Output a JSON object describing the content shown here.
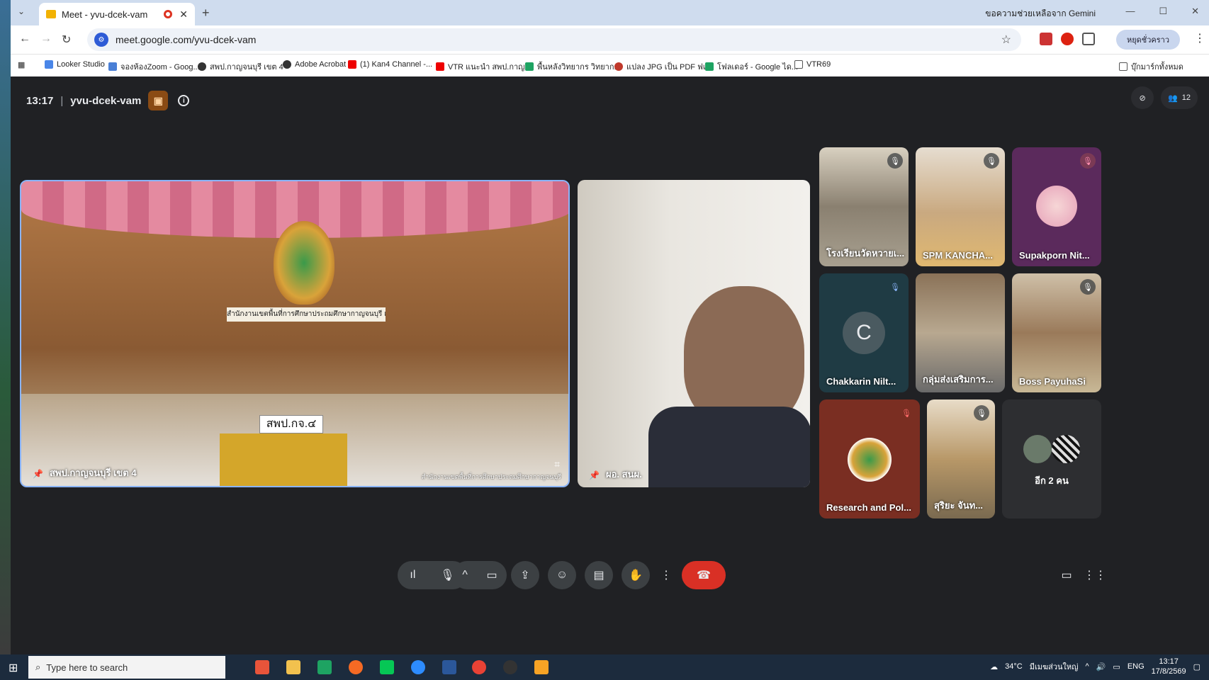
{
  "browser": {
    "tab_title": "Meet - yvu-dcek-vam",
    "close_glyph": "✕",
    "new_tab_glyph": "+",
    "gemini_label": "ขอความช่วยเหลือจาก Gemini",
    "url": "meet.google.com/yvu-dcek-vam",
    "profile_label": "หยุดชั่วคราว",
    "bookmarks": [
      "Looker Studio",
      "จองห้องZoom - Goog...",
      "สพป.กาญจนบุรี เขต 4",
      "Adobe Acrobat",
      "(1) Kan4 Channel -...",
      "VTR แนะนำ สพป.กาญ...",
      "พื้นหลังวิทยากร วิทยาก...",
      "แปลง JPG เป็น PDF ฟเ...",
      "โฟลเดอร์ - Google ได...",
      "VTR69"
    ],
    "all_bookmarks": "บุ๊กมาร์กทั้งหมด"
  },
  "meeting": {
    "time": "13:17",
    "separator": "|",
    "code": "yvu-dcek-vam",
    "participants_count": "12",
    "main_tile_name": "สพป.กาญจนบุรี เขต 4",
    "main_banner": "สำนักงานเขตพื้นที่การศึกษาประถมศึกษากาญจนบุรี เขต ๔",
    "main_placard": "สพป.กจ.๔",
    "main_watermark": "สำนักงานเขตพื้นที่การศึกษาประถมศึกษากาญจนบุรี",
    "second_tile_name": "ผอ. สนผ.",
    "tiles": [
      {
        "name": "โรงเรียนวัดหวายเ...",
        "muted": true
      },
      {
        "name": "SPM KANCHA...",
        "muted": true
      },
      {
        "name": "Supakporn Nit...",
        "muted": true
      },
      {
        "name": "Chakkarin Nilt...",
        "initial": "C",
        "muted": true
      },
      {
        "name": "กลุ่มส่งเสริมการ...",
        "muted": false
      },
      {
        "name": "Boss PayuhaSi",
        "muted": true
      },
      {
        "name": "Research and Pol...",
        "muted": true
      },
      {
        "name": "สุริยะ จันท...",
        "muted": true
      }
    ],
    "more_label": "อีก 2 คน"
  },
  "taskbar": {
    "search_placeholder": "Type here to search",
    "weather": "34°C",
    "weather_desc": "มีเมฆส่วนใหญ่",
    "lang": "ENG",
    "clock_time": "13:17",
    "clock_date": "17/8/2569"
  },
  "colors": {
    "accent": "#1a73e8",
    "end_call": "#d93025",
    "meet_bg": "#202124"
  }
}
